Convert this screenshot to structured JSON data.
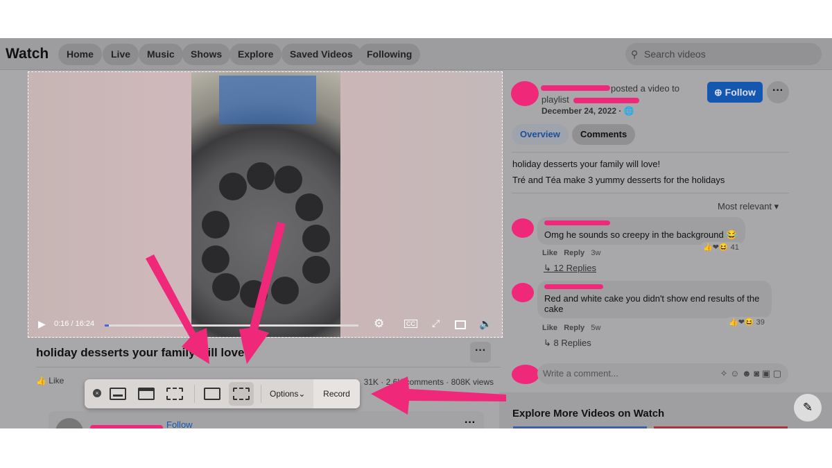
{
  "header": {
    "title": "Watch",
    "nav": [
      "Home",
      "Live",
      "Music",
      "Shows",
      "Explore",
      "Saved Videos",
      "Following"
    ],
    "search_placeholder": "Search videos"
  },
  "video": {
    "current_time": "0:16 / 16:24",
    "progress_percent": 1.6,
    "title": "holiday desserts your family will love!",
    "like_label": "Like",
    "stats": "31K · 2.6K comments · 808K views"
  },
  "post": {
    "posted_text": "posted a video to",
    "playlist_prefix": "playlist",
    "date": "December 24, 2022 ·",
    "follow_label": "Follow",
    "more": "···",
    "tabs": [
      "Overview",
      "Comments"
    ],
    "description": [
      "holiday desserts your family will love!",
      "Tré and Téa make 3 yummy desserts for the holidays"
    ],
    "sort": "Most relevant"
  },
  "comments": [
    {
      "text": "Omg he sounds so creepy in the background 😂",
      "like": "Like",
      "reply": "Reply",
      "age": "3w",
      "reactions": "41",
      "replies": "12 Replies"
    },
    {
      "text": "Red and white cake you didn't show end results of the cake",
      "like": "Like",
      "reply": "Reply",
      "age": "5w",
      "reactions": "39",
      "replies": "8 Replies"
    }
  ],
  "comment_input_placeholder": "Write a comment...",
  "explore_heading": "Explore More Videos on Watch",
  "recorder": {
    "options_label": "Options",
    "record_label": "Record"
  },
  "below_post": {
    "follow_label": "Follow"
  },
  "colors": {
    "annotation": "#f0287a",
    "follow": "#1457b0"
  }
}
